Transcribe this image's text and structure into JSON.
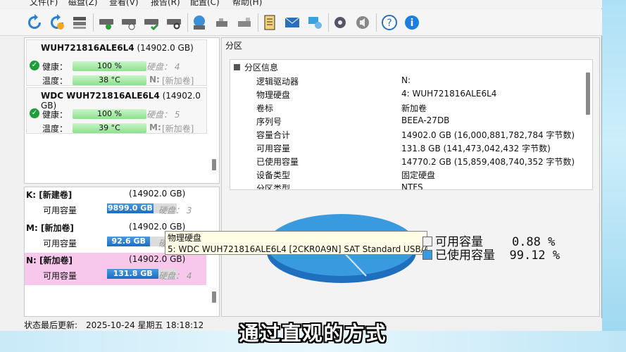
{
  "menu": [
    "文件(F)",
    "磁盘(Z)",
    "查看(V)",
    "报告(R)",
    "配置(C)",
    "帮助(H)"
  ],
  "toolbar_icons": [
    "refresh-icon",
    "refresh-warn-icon",
    "drive-list-icon",
    "disk-health-icon",
    "disk-schedule-icon",
    "disk-check-icon",
    "disk-search-icon",
    "network-drive-icon",
    "usb-drive-icon",
    "usb-drive2-icon",
    "report-icon",
    "email-icon",
    "network-icon",
    "settings-icon",
    "sound-icon",
    "help-icon",
    "info-icon"
  ],
  "disks": [
    {
      "name": "WUH721816ALE6L4",
      "size": "(14902.0 GB)",
      "health_label": "健康：",
      "health_value": "100 %",
      "temp_label": "温度：",
      "temp_value": "38 °C",
      "disk_label": "硬盘： 4",
      "volume": "N:",
      "volume_name": "[新加卷]"
    },
    {
      "name": "WDC  WUH721816ALE6L4",
      "size": "(14902.0 GB)",
      "health_label": "健康：",
      "health_value": "100 %",
      "temp_label": "温度：",
      "temp_value": "39 °C",
      "disk_label": "硬盘： 5",
      "volume": "M:",
      "volume_name": "[新加卷]"
    }
  ],
  "volumes": [
    {
      "name": "K: [新建卷]",
      "size": "(14902.0 GB)",
      "label": "可用容量",
      "free": "9899.0 GB",
      "free_fraction": 0.664,
      "disk": "硬盘： 3",
      "highlight": false
    },
    {
      "name": "M: [新加卷]",
      "size": "(14902.0 GB)",
      "label": "可用容量",
      "free": "92.6 GB",
      "free_fraction": 0.62,
      "disk": "硬盘： 5",
      "highlight": false
    },
    {
      "name": "N: [新加卷]",
      "size": "(14902.0 GB)",
      "label": "可用容量",
      "free": "131.8 GB",
      "free_fraction": 0.74,
      "disk": "硬盘： 4",
      "highlight": true
    }
  ],
  "partition": {
    "title": "分区",
    "section": "分区信息",
    "rows": [
      {
        "key": "逻辑驱动器",
        "value": "N:"
      },
      {
        "key": "物理硬盘",
        "value": "4: WUH721816ALE6L4"
      },
      {
        "key": "卷标",
        "value": "新加卷"
      },
      {
        "key": "序列号",
        "value": "BEEA-27DB"
      },
      {
        "key": "容量合计",
        "value": "14902.0 GB (16,000,881,782,784 字节数)"
      },
      {
        "key": "可用容量",
        "value": "131.8 GB (141,473,042,432 字节数)"
      },
      {
        "key": "已使用容量",
        "value": "14770.2 GB (15,859,408,740,352 字节数)"
      },
      {
        "key": "设备类型",
        "value": "固定硬盘"
      },
      {
        "key": "分区类型",
        "value": "NTFS"
      }
    ]
  },
  "tooltip": {
    "line1": "物理硬盘",
    "line2": "5: WDC  WUH721816ALE6L4 [2CKR0A9N] SAT Standard USB/ATA"
  },
  "pie": {
    "free_label": "可用容量",
    "free_value": "0.88 %",
    "used_label": "已使用容量",
    "used_value": "99.12 %",
    "free_pct": 0.88,
    "used_pct": 99.12,
    "free_color": "#f0f0f0",
    "used_color": "#3a9ae0"
  },
  "status": {
    "label": "状态最后更新:",
    "value": "2025-10-24 星期五 18:18:12"
  },
  "subtitle": "通过直观的方式"
}
